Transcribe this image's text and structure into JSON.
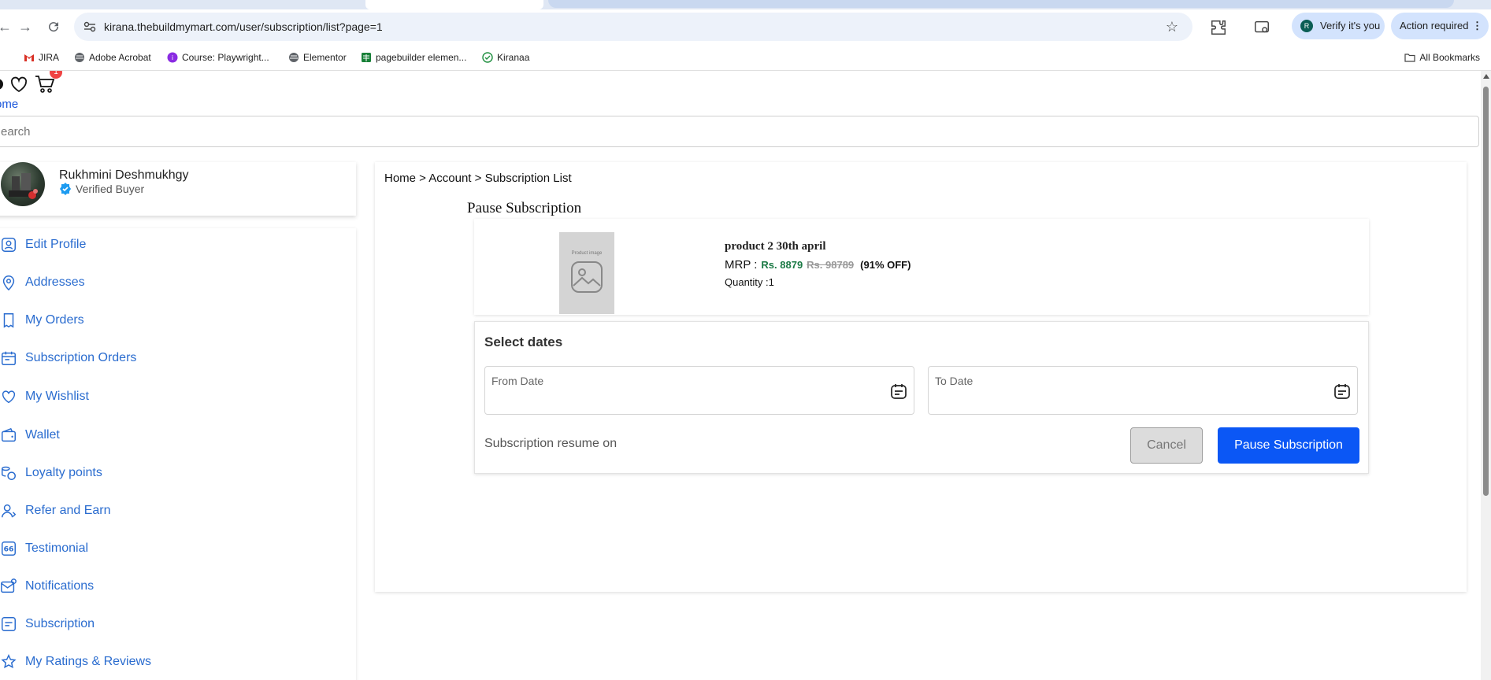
{
  "browser": {
    "url": "kirana.thebuildmymart.com/user/subscription/list?page=1",
    "verify_chip": "Verify it's you",
    "verify_avatar_letter": "R",
    "action_chip": "Action required",
    "bookmarks": [
      "JIRA",
      "Adobe Acrobat",
      "Course: Playwright...",
      "Elementor",
      "pagebuilder elemen...",
      "Kiranaa"
    ],
    "all_bookmarks": "All Bookmarks"
  },
  "header": {
    "cart_count": "1",
    "home_link": "ome",
    "search_placeholder": "earch"
  },
  "profile": {
    "name": "Rukhmini Deshmukhgy",
    "badge": "Verified Buyer"
  },
  "sidebar": {
    "items": [
      {
        "label": "Edit Profile",
        "icon": "user-icon"
      },
      {
        "label": "Addresses",
        "icon": "location-pin-icon"
      },
      {
        "label": "My Orders",
        "icon": "receipt-icon"
      },
      {
        "label": "Subscription Orders",
        "icon": "calendar-icon"
      },
      {
        "label": "My Wishlist",
        "icon": "heart-icon"
      },
      {
        "label": "Wallet",
        "icon": "wallet-icon"
      },
      {
        "label": "Loyalty points",
        "icon": "coins-icon"
      },
      {
        "label": "Refer and Earn",
        "icon": "refer-user-icon"
      },
      {
        "label": "Testimonial",
        "icon": "quote-icon"
      },
      {
        "label": "Notifications",
        "icon": "mail-notification-icon"
      },
      {
        "label": "Subscription",
        "icon": "subscription-icon"
      },
      {
        "label": "My Ratings & Reviews",
        "icon": "star-review-icon"
      }
    ]
  },
  "main": {
    "breadcrumb": "Home > Account > Subscription List",
    "title": "Pause Subscription",
    "product": {
      "image_placeholder": "Product image",
      "name": "product 2 30th april",
      "mrp_label": "MRP :",
      "price": "Rs. 8879",
      "old_price": "Rs. 98789",
      "discount": "(91% OFF)",
      "quantity": "Quantity :1"
    },
    "dates": {
      "title": "Select dates",
      "from_label": "From Date",
      "to_label": "To Date",
      "resume_text": "Subscription resume on",
      "cancel_label": "Cancel",
      "pause_label": "Pause Subscription"
    }
  },
  "colors": {
    "link_blue": "#2a6ccf",
    "primary_button": "#0b57f5",
    "price_green": "#1b7a45",
    "badge_red": "#ef4444"
  }
}
